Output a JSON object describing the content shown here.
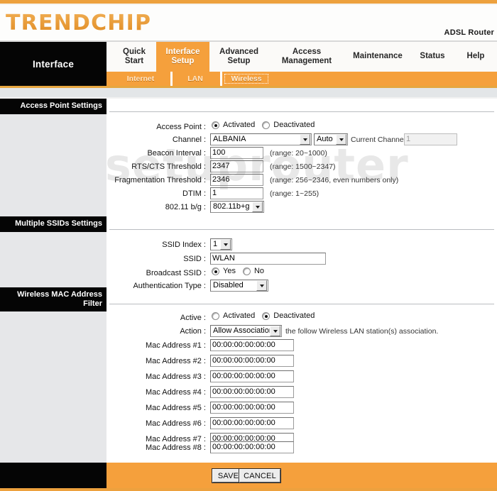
{
  "header": {
    "brand": "TRENDCHIP",
    "device_label": "ADSL Router",
    "section_block": "Interface"
  },
  "nav": {
    "tabs": [
      {
        "label": "Quick\nStart",
        "line1": "Quick",
        "line2": "Start",
        "active": false
      },
      {
        "label": "Interface Setup",
        "line1": "Interface",
        "line2": "Setup",
        "active": true
      },
      {
        "label": "Advanced Setup",
        "line1": "Advanced",
        "line2": "Setup",
        "active": false
      },
      {
        "label": "Access Management",
        "line1": "Access",
        "line2": "Management",
        "active": false
      },
      {
        "label": "Maintenance",
        "line1": "Maintenance",
        "line2": "",
        "active": false
      },
      {
        "label": "Status",
        "line1": "Status",
        "line2": "",
        "active": false
      },
      {
        "label": "Help",
        "line1": "Help",
        "line2": "",
        "active": false
      }
    ],
    "subtabs": [
      {
        "label": "Internet",
        "selected": false
      },
      {
        "label": "LAN",
        "selected": false
      },
      {
        "label": "Wireless",
        "selected": true
      }
    ]
  },
  "watermark": "setuprouter",
  "sections": {
    "access_point": {
      "title": "Access Point Settings",
      "access_point_label": "Access Point :",
      "access_point_options": [
        "Activated",
        "Deactivated"
      ],
      "access_point_value": "Activated",
      "channel_label": "Channel :",
      "channel_value": "ALBANIA",
      "channel_auto_value": "Auto",
      "current_channel_label": "Current Channel:",
      "current_channel_value": "1",
      "beacon_label": "Beacon Interval :",
      "beacon_value": "100",
      "beacon_hint": "(range: 20~1000)",
      "rts_label": "RTS/CTS Threshold :",
      "rts_value": "2347",
      "rts_hint": "(range: 1500~2347)",
      "frag_label": "Fragmentation Threshold :",
      "frag_value": "2346",
      "frag_hint": "(range: 256~2346, even numbers only)",
      "dtim_label": "DTIM :",
      "dtim_value": "1",
      "dtim_hint": "(range: 1~255)",
      "mode_label": "802.11 b/g :",
      "mode_value": "802.11b+g"
    },
    "multiple_ssids": {
      "title": "Multiple SSIDs Settings",
      "ssid_index_label": "SSID Index :",
      "ssid_index_value": "1",
      "ssid_label": "SSID :",
      "ssid_value": "WLAN",
      "broadcast_label": "Broadcast SSID :",
      "broadcast_options": [
        "Yes",
        "No"
      ],
      "broadcast_value": "Yes",
      "auth_label": "Authentication Type :",
      "auth_value": "Disabled"
    },
    "mac_filter": {
      "title_line1": "Wireless MAC Address",
      "title_line2": "Filter",
      "active_label": "Active :",
      "active_options": [
        "Activated",
        "Deactivated"
      ],
      "active_value": "Deactivated",
      "action_label": "Action :",
      "action_value": "Allow Association",
      "action_hint": "the follow Wireless LAN station(s) association.",
      "mac_rows": [
        {
          "label": "Mac Address #1 :",
          "value": "00:00:00:00:00:00"
        },
        {
          "label": "Mac Address #2 :",
          "value": "00:00:00:00:00:00"
        },
        {
          "label": "Mac Address #3 :",
          "value": "00:00:00:00:00:00"
        },
        {
          "label": "Mac Address #4 :",
          "value": "00:00:00:00:00:00"
        },
        {
          "label": "Mac Address #5 :",
          "value": "00:00:00:00:00:00"
        },
        {
          "label": "Mac Address #6 :",
          "value": "00:00:00:00:00:00"
        },
        {
          "label": "Mac Address #7 :",
          "value": "00:00:00:00:00:00"
        },
        {
          "label": "Mac Address #8 :",
          "value": "00:00:00:00:00:00"
        }
      ]
    }
  },
  "footer": {
    "save_label": "SAVE",
    "cancel_label": "CANCEL"
  },
  "colors": {
    "orange": "#f5a03c",
    "orange_rule": "#eda13e",
    "black": "#050505",
    "sidebar_grey": "#e6e7e9",
    "brand_orange": "#e9952f"
  }
}
